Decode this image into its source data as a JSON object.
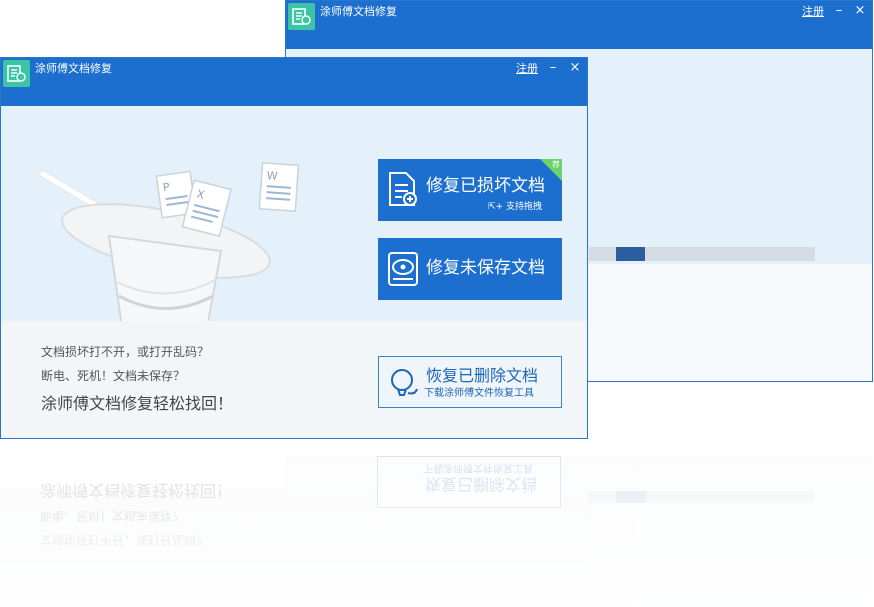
{
  "window": {
    "title": "涂师傅文档修复",
    "register_label": "注册",
    "minimize_glyph": "–",
    "close_glyph": "×"
  },
  "buttons": {
    "repair": {
      "label": "修复已损坏文档",
      "sub": "支持拖拽",
      "badge": "荐",
      "icon": "repair-doc-icon"
    },
    "unsaved": {
      "label": "修复未保存文档",
      "icon": "disk-drive-icon"
    },
    "restore": {
      "label": "恢复已删除文档",
      "sub": "下载涂师傅文件恢复工具",
      "icon": "lightbulb-icon"
    }
  },
  "promo": {
    "line1": "文档损坏打不开，或打开乱码？",
    "line2": "断电、死机！文档未保存？",
    "line3": "涂师傅文档修复轻松找回！"
  },
  "progress": {
    "fraction": 0.13
  },
  "colors": {
    "titlebar": "#1c6fce",
    "accent": "#1c6fce",
    "logo": "#3cc4a7",
    "badge": "#6bd36b",
    "panel_bg": "#e4f1fa"
  }
}
